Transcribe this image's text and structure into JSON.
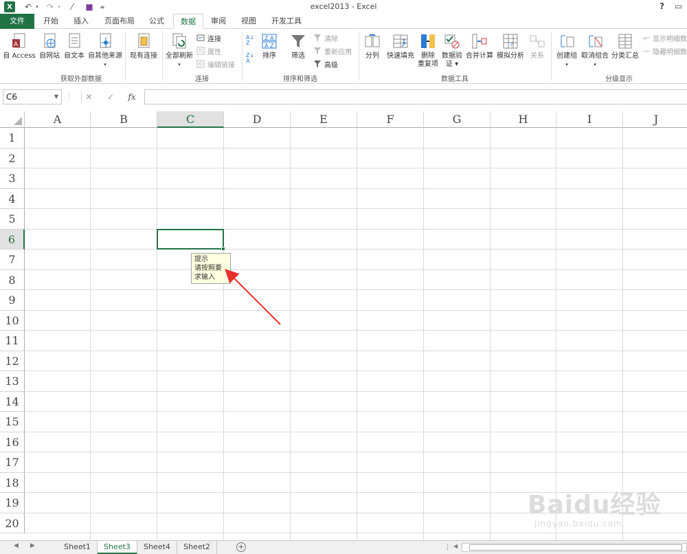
{
  "window": {
    "title": "excel2013 - Excel",
    "help": "?"
  },
  "tabs": [
    {
      "label": "文件"
    },
    {
      "label": "开始"
    },
    {
      "label": "插入"
    },
    {
      "label": "页面布局"
    },
    {
      "label": "公式"
    },
    {
      "label": "数据"
    },
    {
      "label": "审阅"
    },
    {
      "label": "视图"
    },
    {
      "label": "开发工具"
    }
  ],
  "ribbon": {
    "get_external": {
      "group_label": "获取外部数据",
      "access": "自 Access",
      "web": "自网站",
      "text": "自文本",
      "other": "自其他来源",
      "existing": "现有连接"
    },
    "connections": {
      "group_label": "连接",
      "refresh_all": "全部刷新",
      "connections": "连接",
      "properties": "属性",
      "edit_links": "编辑链接"
    },
    "sort_filter": {
      "group_label": "排序和筛选",
      "sort": "排序",
      "filter": "筛选",
      "clear": "清除",
      "reapply": "重新应用",
      "advanced": "高级"
    },
    "data_tools": {
      "group_label": "数据工具",
      "text_to_columns": "分列",
      "flash_fill": "快速填充",
      "remove_dup_1": "删除",
      "remove_dup_2": "重复项",
      "validation_1": "数据验",
      "validation_2": "证",
      "consolidate": "合并计算",
      "what_if": "模拟分析",
      "relationships": "关系"
    },
    "outline": {
      "group_label": "分级显示",
      "group": "创建组",
      "ungroup": "取消组合",
      "subtotal": "分类汇总",
      "show_detail": "显示明细数",
      "hide_detail": "隐藏明细数"
    }
  },
  "formula_bar": {
    "name_box": "C6",
    "fx": "fx",
    "value": ""
  },
  "columns": [
    "A",
    "B",
    "C",
    "D",
    "E",
    "F",
    "G",
    "H",
    "I",
    "J"
  ],
  "rows": [
    "1",
    "2",
    "3",
    "4",
    "5",
    "6",
    "7",
    "8",
    "9",
    "10",
    "11",
    "12",
    "13",
    "14",
    "15",
    "16",
    "17",
    "18",
    "19",
    "20"
  ],
  "selected_cell": "C6",
  "tooltip": {
    "title": "提示",
    "message": "请按照要求输入"
  },
  "sheets": [
    {
      "label": "Sheet1",
      "active": false
    },
    {
      "label": "Sheet3",
      "active": true
    },
    {
      "label": "Sheet4",
      "active": false
    },
    {
      "label": "Sheet2",
      "active": false
    }
  ],
  "watermark": {
    "logo": "Baidu经验",
    "url": "jingyan.baidu.com"
  },
  "colors": {
    "accent": "#217346",
    "annotation_arrow": "#e8302a",
    "tooltip_bg": "#ffffe1"
  }
}
